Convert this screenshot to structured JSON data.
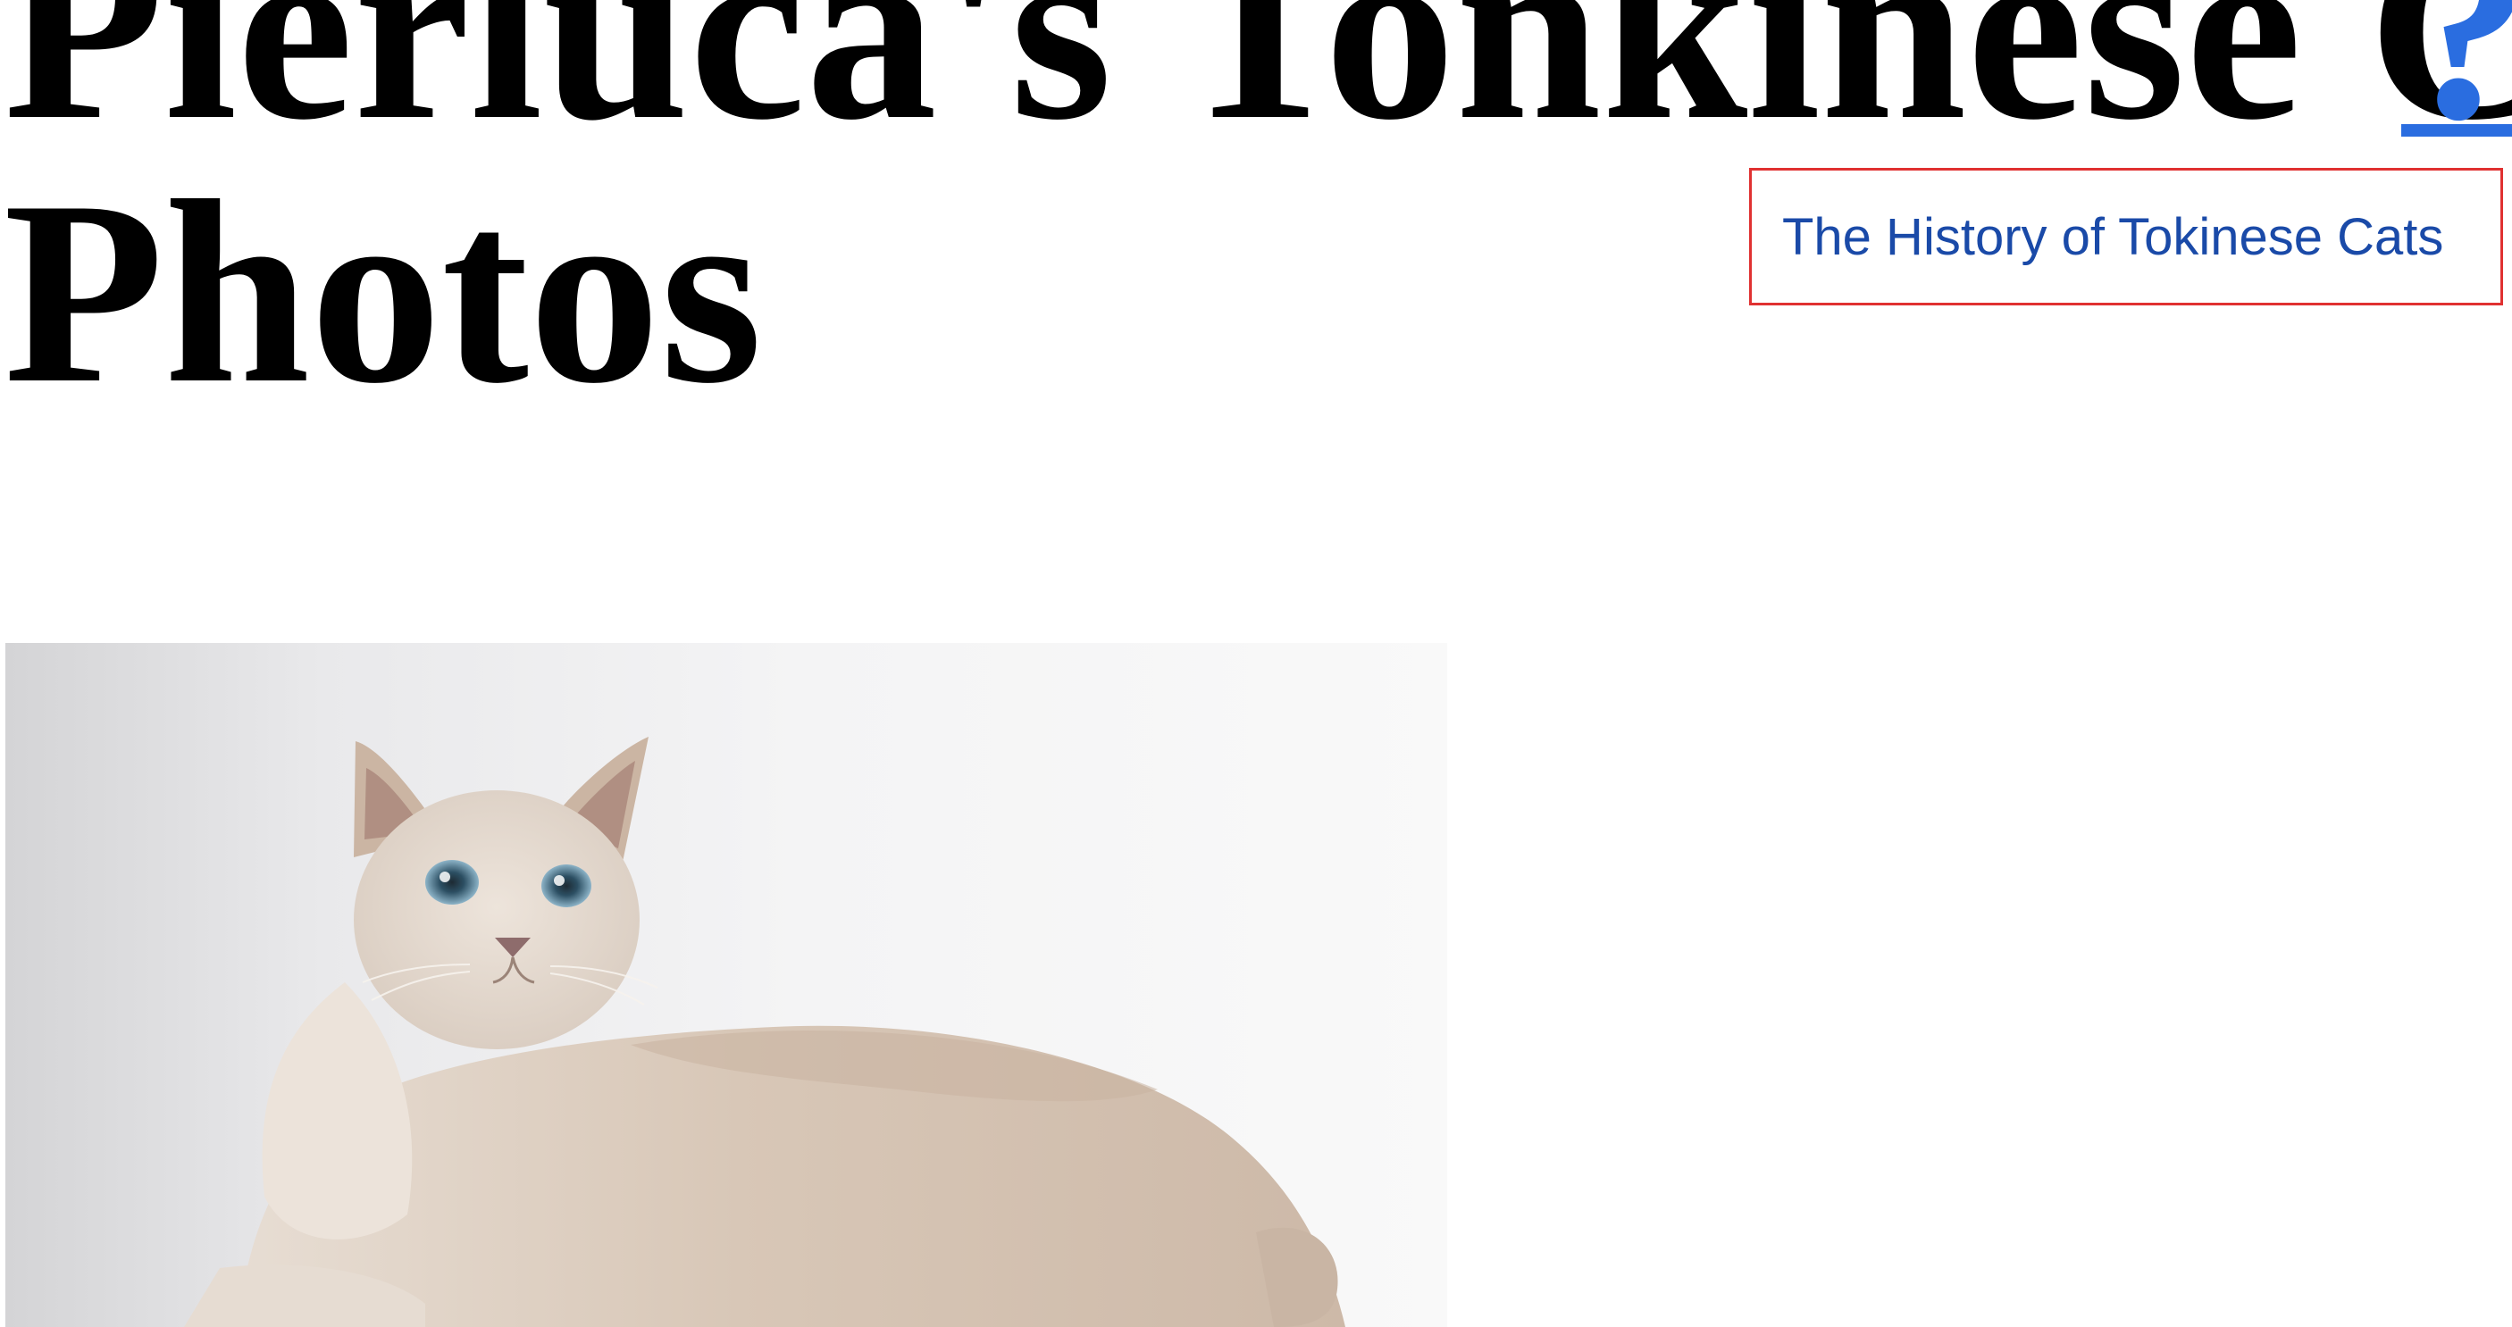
{
  "heading": {
    "line1": "Pierluca's Tonkinese Cat",
    "line2": "Photos",
    "help_glyph": "?"
  },
  "tooltip": {
    "text": "The History of Tokinese Cats"
  },
  "colors": {
    "link": "#2a6de0",
    "tooltip_text": "#1a4aa8",
    "tooltip_border": "#e03131",
    "heading": "#000000"
  },
  "photo": {
    "icon": "cat-photo"
  }
}
